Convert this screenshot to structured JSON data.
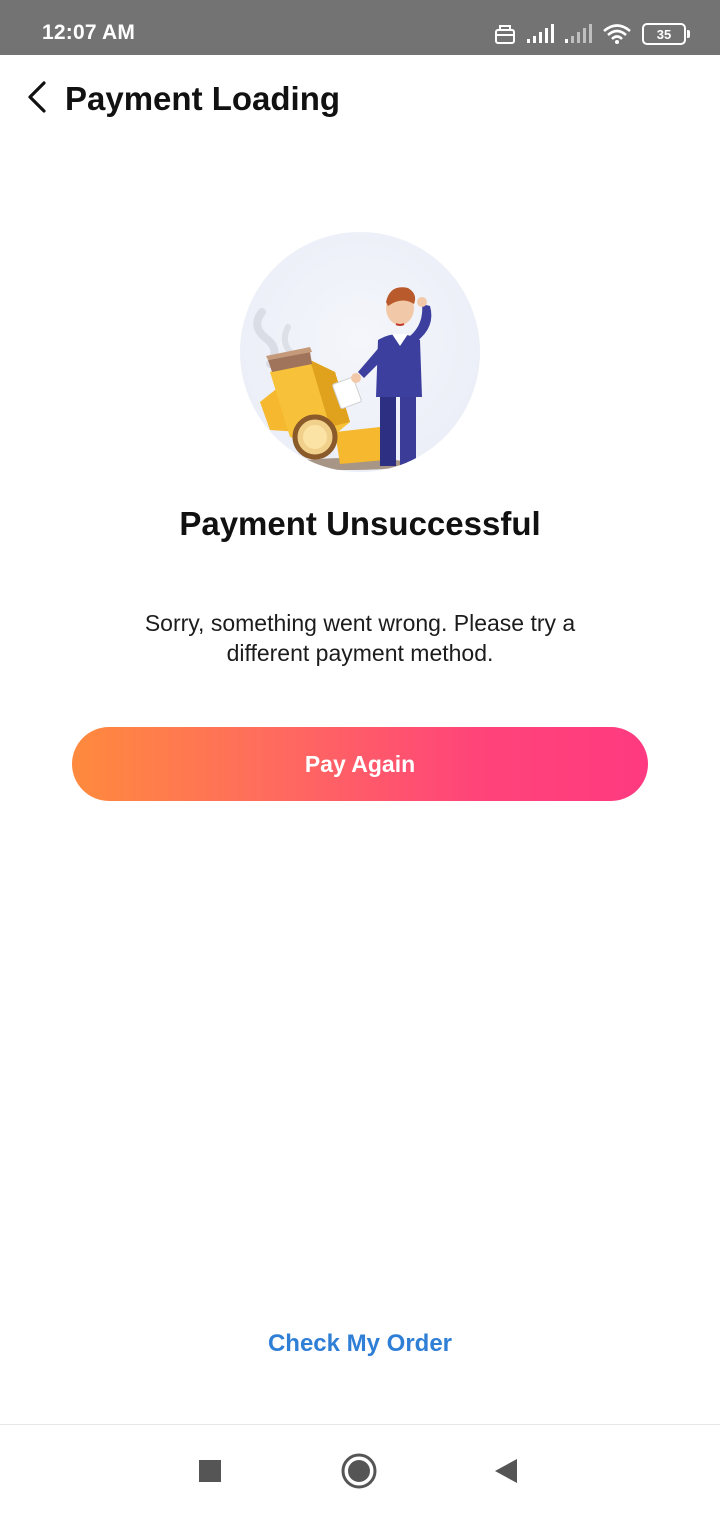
{
  "status_bar": {
    "time": "12:07 AM",
    "battery": "35",
    "icons": [
      "sim-card-icon",
      "signal-icon",
      "signal-weak-icon",
      "wifi-icon",
      "battery-icon"
    ]
  },
  "header": {
    "title": "Payment Loading",
    "back_icon": "chevron-left-icon"
  },
  "result": {
    "illustration": "failed-payment-illustration",
    "title": "Payment Unsuccessful",
    "message": "Sorry, something went wrong. Please try a different payment method."
  },
  "actions": {
    "pay_again_label": "Pay Again",
    "check_order_label": "Check My Order"
  },
  "nav_bar": {
    "icons": [
      "recents-icon",
      "home-icon",
      "back-icon"
    ]
  },
  "colors": {
    "status_bar": "#737373",
    "button_gradient_start": "#ff8a3d",
    "button_gradient_end": "#ff3a80",
    "link": "#2f7fd6"
  }
}
